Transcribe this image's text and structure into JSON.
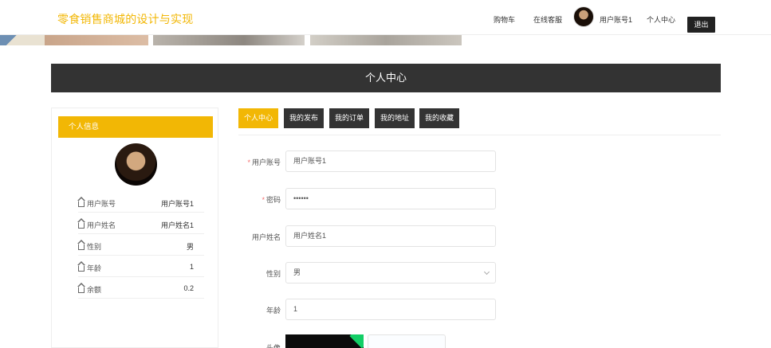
{
  "header": {
    "site_title": "零食销售商城的设计与实现",
    "nav": [
      {
        "label": "购物车"
      },
      {
        "label": "在线客服"
      }
    ],
    "username": "用户账号1",
    "personal_center": "个人中心",
    "logout": "退出"
  },
  "page": {
    "title": "个人中心"
  },
  "profile": {
    "section_title": "个人信息",
    "rows": [
      {
        "label": "用户账号",
        "value": "用户账号1",
        "icon": "house-icon"
      },
      {
        "label": "用户姓名",
        "value": "用户姓名1",
        "icon": "house-icon"
      },
      {
        "label": "性别",
        "value": "男",
        "icon": "house-icon"
      },
      {
        "label": "年龄",
        "value": "1",
        "icon": "house-icon"
      },
      {
        "label": "余额",
        "value": "0.2",
        "icon": "house-icon"
      }
    ]
  },
  "tabs": [
    {
      "label": "个人中心",
      "active": true
    },
    {
      "label": "我的发布",
      "active": false
    },
    {
      "label": "我的订单",
      "active": false
    },
    {
      "label": "我的地址",
      "active": false
    },
    {
      "label": "我的收藏",
      "active": false
    }
  ],
  "form": {
    "account": {
      "label": "用户账号",
      "required": "*",
      "value": "用户账号1"
    },
    "password": {
      "label": "密码",
      "required": "*",
      "value": "••••••"
    },
    "name": {
      "label": "用户姓名",
      "value": "用户姓名1"
    },
    "gender": {
      "label": "性别",
      "value": "男"
    },
    "age": {
      "label": "年龄",
      "value": "1"
    },
    "avatar": {
      "label": "头像"
    }
  },
  "colors": {
    "accent": "#f2b705",
    "dark": "#333333"
  }
}
